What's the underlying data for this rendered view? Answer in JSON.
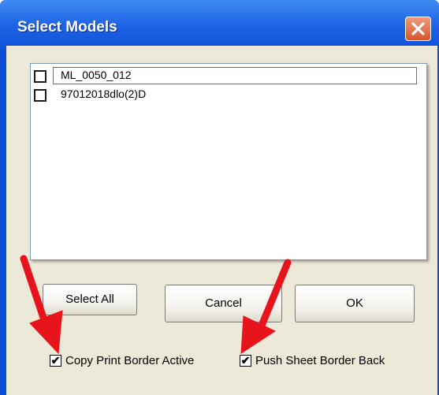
{
  "window": {
    "title": "Select Models",
    "close_icon": "close-icon"
  },
  "models_list": {
    "items": [
      {
        "label": "ML_0050_012",
        "checked": false
      },
      {
        "label": "97012018dlo(2)D",
        "checked": false
      }
    ]
  },
  "buttons": {
    "select_all": "Select All",
    "cancel": "Cancel",
    "ok": "OK"
  },
  "options": {
    "copy_print_border": {
      "label": "Copy Print Border Active",
      "checked": true
    },
    "push_sheet_border": {
      "label": "Push Sheet Border Back",
      "checked": true
    },
    "check_mark": "✔"
  },
  "annotations": {
    "arrow_color": "#e8141b",
    "arrow_icon": "red-arrow-icon"
  }
}
